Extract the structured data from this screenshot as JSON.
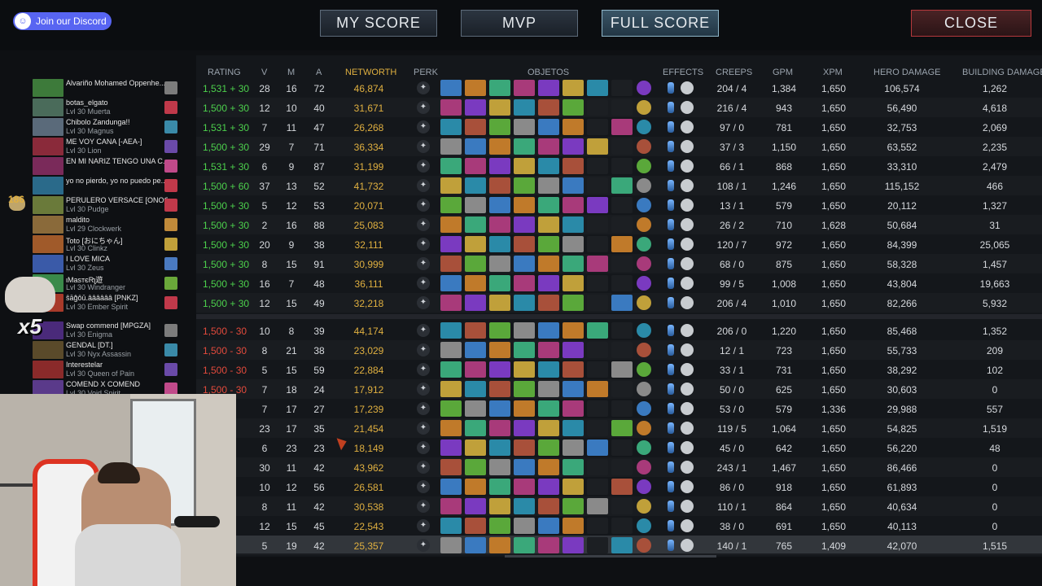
{
  "discord": {
    "label": "Join our Discord"
  },
  "tabs": {
    "my_score": "MY SCORE",
    "mvp": "MVP",
    "full_score": "FULL SCORE",
    "close": "CLOSE"
  },
  "headers": {
    "rating": "RATING",
    "v": "V",
    "m": "M",
    "a": "A",
    "networth": "NETWORTH",
    "perk": "PERK",
    "objetos": "OBJETOS",
    "effects": "EFFECTS",
    "creeps": "CREEPS",
    "gpm": "GPM",
    "xpm": "XPM",
    "hero_damage": "HERO DAMAGE",
    "building_damage": "BUILDING DAMAGE"
  },
  "overlay": {
    "kills": "186",
    "emote_text": "x5"
  },
  "colors": {
    "win": "#4cd04c",
    "loss": "#e24a3c",
    "networth": "#e0b040"
  },
  "players": [
    {
      "name": "Alvariño Mohamed Oppenhe...",
      "level": "",
      "rating": "1,531 + 30",
      "result": "win",
      "k": "28",
      "d": "16",
      "a": "72",
      "networth": "46,874",
      "creeps": "204 / 4",
      "gpm": "1,384",
      "xpm": "1,650",
      "hero_damage": "106,574",
      "building_damage": "1,262",
      "portrait_color": "#3d7a3a",
      "talent_color": "#7c7c7c"
    },
    {
      "name": "botas_elgato",
      "level": "Lvl 30 Muerta",
      "rating": "1,500 + 30",
      "result": "win",
      "k": "12",
      "d": "10",
      "a": "40",
      "networth": "31,671",
      "creeps": "216 / 4",
      "gpm": "943",
      "xpm": "1,650",
      "hero_damage": "56,490",
      "building_damage": "4,618",
      "portrait_color": "#4a6b5a",
      "talent_color": "#c0394a"
    },
    {
      "name": "Chibolo Zandunga!!",
      "level": "Lvl 30 Magnus",
      "rating": "1,531 + 30",
      "result": "win",
      "k": "7",
      "d": "11",
      "a": "47",
      "networth": "26,268",
      "creeps": "97 / 0",
      "gpm": "781",
      "xpm": "1,650",
      "hero_damage": "32,753",
      "building_damage": "2,069",
      "portrait_color": "#5a6a7a",
      "talent_color": "#3a8aa8"
    },
    {
      "name": "ME VOY CANA [-AEA-]",
      "level": "Lvl 30 Lion",
      "rating": "1,500 + 30",
      "result": "win",
      "k": "29",
      "d": "7",
      "a": "71",
      "networth": "36,334",
      "creeps": "37 / 3",
      "gpm": "1,150",
      "xpm": "1,650",
      "hero_damage": "63,552",
      "building_damage": "2,235",
      "portrait_color": "#8a2a3a",
      "talent_color": "#6a4aa8"
    },
    {
      "name": "EN MI NARIZ TENGO UNA C...",
      "level": "",
      "rating": "1,531 + 30",
      "result": "win",
      "k": "6",
      "d": "9",
      "a": "87",
      "networth": "31,199",
      "creeps": "66 / 1",
      "gpm": "868",
      "xpm": "1,650",
      "hero_damage": "33,310",
      "building_damage": "2,479",
      "portrait_color": "#7a2a5a",
      "talent_color": "#c04a8a"
    },
    {
      "name": "yo no pierdo, yo no puedo pe...",
      "level": "",
      "rating": "1,500 + 60",
      "result": "win",
      "k": "37",
      "d": "13",
      "a": "52",
      "networth": "41,732",
      "creeps": "108 / 1",
      "gpm": "1,246",
      "xpm": "1,650",
      "hero_damage": "115,152",
      "building_damage": "466",
      "portrait_color": "#2a6a8a",
      "talent_color": "#c0394a"
    },
    {
      "name": "PERULERO VERSACE [ONOOO]",
      "level": "Lvl 30 Pudge",
      "rating": "1,500 + 30",
      "result": "win",
      "k": "5",
      "d": "12",
      "a": "53",
      "networth": "20,071",
      "creeps": "13 / 1",
      "gpm": "579",
      "xpm": "1,650",
      "hero_damage": "20,112",
      "building_damage": "1,327",
      "portrait_color": "#6a7a3a",
      "talent_color": "#c0394a"
    },
    {
      "name": "maldito",
      "level": "Lvl 29 Clockwerk",
      "rating": "1,500 + 30",
      "result": "win",
      "k": "2",
      "d": "16",
      "a": "88",
      "networth": "25,083",
      "creeps": "26 / 2",
      "gpm": "710",
      "xpm": "1,628",
      "hero_damage": "50,684",
      "building_damage": "31",
      "portrait_color": "#8a6a3a",
      "talent_color": "#c08a3a"
    },
    {
      "name": "Toto [おにちゃん]",
      "level": "Lvl 30 Clinkz",
      "rating": "1,500 + 30",
      "result": "win",
      "k": "20",
      "d": "9",
      "a": "38",
      "networth": "32,111",
      "creeps": "120 / 7",
      "gpm": "972",
      "xpm": "1,650",
      "hero_damage": "84,399",
      "building_damage": "25,065",
      "portrait_color": "#a05a2a",
      "talent_color": "#c0a03a"
    },
    {
      "name": "I LOVE MICA",
      "level": "Lvl 30 Zeus",
      "rating": "1,500 + 30",
      "result": "win",
      "k": "8",
      "d": "15",
      "a": "91",
      "networth": "30,999",
      "creeps": "68 / 0",
      "gpm": "875",
      "xpm": "1,650",
      "hero_damage": "58,328",
      "building_damage": "1,457",
      "portrait_color": "#3a5aa8",
      "talent_color": "#4a7ac0"
    },
    {
      "name": "ιMasтєRʅ遊",
      "level": "Lvl 30 Windranger",
      "rating": "1,500 + 30",
      "result": "win",
      "k": "16",
      "d": "7",
      "a": "48",
      "networth": "36,111",
      "creeps": "99 / 5",
      "gpm": "1,008",
      "xpm": "1,650",
      "hero_damage": "43,804",
      "building_damage": "19,663",
      "portrait_color": "#3a8a4a",
      "talent_color": "#6aa83a"
    },
    {
      "name": "ŝāĝ̄ôū.ââââââ [PNKZ]",
      "level": "Lvl 30 Ember Spirit",
      "rating": "1,500 + 30",
      "result": "win",
      "k": "12",
      "d": "15",
      "a": "49",
      "networth": "32,218",
      "creeps": "206 / 4",
      "gpm": "1,010",
      "xpm": "1,650",
      "hero_damage": "82,266",
      "building_damage": "5,932",
      "portrait_color": "#a83a2a",
      "talent_color": "#c0394a"
    },
    {
      "name": "Swap commend [MPGZA]",
      "level": "Lvl 30 Enigma",
      "rating": "1,500 - 30",
      "result": "loss",
      "k": "10",
      "d": "8",
      "a": "39",
      "networth": "44,174",
      "creeps": "206 / 0",
      "gpm": "1,220",
      "xpm": "1,650",
      "hero_damage": "85,468",
      "building_damage": "1,352",
      "portrait_color": "#4a2a7a",
      "talent_color": "#7c7c7c"
    },
    {
      "name": "GENDAL [DT.]",
      "level": "Lvl 30 Nyx Assassin",
      "rating": "1,500 - 30",
      "result": "loss",
      "k": "8",
      "d": "21",
      "a": "38",
      "networth": "23,029",
      "creeps": "12 / 1",
      "gpm": "723",
      "xpm": "1,650",
      "hero_damage": "55,733",
      "building_damage": "209",
      "portrait_color": "#5a4a2a",
      "talent_color": "#3a8aa8"
    },
    {
      "name": "Interestelar",
      "level": "Lvl 30 Queen of Pain",
      "rating": "1,500 - 30",
      "result": "loss",
      "k": "5",
      "d": "15",
      "a": "59",
      "networth": "22,884",
      "creeps": "33 / 1",
      "gpm": "731",
      "xpm": "1,650",
      "hero_damage": "38,292",
      "building_damage": "102",
      "portrait_color": "#8a2a2a",
      "talent_color": "#6a4aa8"
    },
    {
      "name": "COMEND X COMEND",
      "level": "Lvl 30 Void Spirit",
      "rating": "1,500 - 30",
      "result": "loss",
      "k": "7",
      "d": "18",
      "a": "24",
      "networth": "17,912",
      "creeps": "50 / 0",
      "gpm": "625",
      "xpm": "1,650",
      "hero_damage": "30,603",
      "building_damage": "0",
      "portrait_color": "#5a3a8a",
      "talent_color": "#c04a8a"
    },
    {
      "name": "",
      "level": "",
      "rating": "30",
      "result": "loss",
      "k": "7",
      "d": "17",
      "a": "27",
      "networth": "17,239",
      "creeps": "53 / 0",
      "gpm": "579",
      "xpm": "1,336",
      "hero_damage": "29,988",
      "building_damage": "557",
      "portrait_color": "#333",
      "talent_color": "#333"
    },
    {
      "name": "",
      "level": "",
      "rating": "30",
      "result": "loss",
      "k": "23",
      "d": "17",
      "a": "35",
      "networth": "21,454",
      "creeps": "119 / 5",
      "gpm": "1,064",
      "xpm": "1,650",
      "hero_damage": "54,825",
      "building_damage": "1,519",
      "portrait_color": "#333",
      "talent_color": "#333"
    },
    {
      "name": "",
      "level": "",
      "rating": "30",
      "result": "loss",
      "k": "6",
      "d": "23",
      "a": "23",
      "networth": "18,149",
      "creeps": "45 / 0",
      "gpm": "642",
      "xpm": "1,650",
      "hero_damage": "56,220",
      "building_damage": "48",
      "portrait_color": "#333",
      "talent_color": "#333"
    },
    {
      "name": "",
      "level": "",
      "rating": "30",
      "result": "loss",
      "k": "30",
      "d": "11",
      "a": "42",
      "networth": "43,962",
      "creeps": "243 / 1",
      "gpm": "1,467",
      "xpm": "1,650",
      "hero_damage": "86,466",
      "building_damage": "0",
      "portrait_color": "#333",
      "talent_color": "#333"
    },
    {
      "name": "",
      "level": "",
      "rating": "30",
      "result": "loss",
      "k": "10",
      "d": "12",
      "a": "56",
      "networth": "26,581",
      "creeps": "86 / 0",
      "gpm": "918",
      "xpm": "1,650",
      "hero_damage": "61,893",
      "building_damage": "0",
      "portrait_color": "#333",
      "talent_color": "#333"
    },
    {
      "name": "",
      "level": "",
      "rating": "30",
      "result": "loss",
      "k": "8",
      "d": "11",
      "a": "42",
      "networth": "30,538",
      "creeps": "110 / 1",
      "gpm": "864",
      "xpm": "1,650",
      "hero_damage": "40,634",
      "building_damage": "0",
      "portrait_color": "#333",
      "talent_color": "#333"
    },
    {
      "name": "",
      "level": "",
      "rating": "30",
      "result": "loss",
      "k": "12",
      "d": "15",
      "a": "45",
      "networth": "22,543",
      "creeps": "38 / 0",
      "gpm": "691",
      "xpm": "1,650",
      "hero_damage": "40,113",
      "building_damage": "0",
      "portrait_color": "#333",
      "talent_color": "#333"
    },
    {
      "name": "",
      "level": "",
      "rating": "",
      "result": "loss",
      "k": "5",
      "d": "19",
      "a": "42",
      "networth": "25,357",
      "creeps": "140 / 1",
      "gpm": "765",
      "xpm": "1,409",
      "hero_damage": "42,070",
      "building_damage": "1,515",
      "portrait_color": "#333",
      "talent_color": "#333"
    }
  ],
  "item_colors": [
    "#3a7ac0",
    "#c07a2a",
    "#3aa87a",
    "#a83a7a",
    "#7a3ac0",
    "#c0a03a",
    "#2a8aa8",
    "#a8503a",
    "#5aa83a",
    "#8a8a8a"
  ]
}
